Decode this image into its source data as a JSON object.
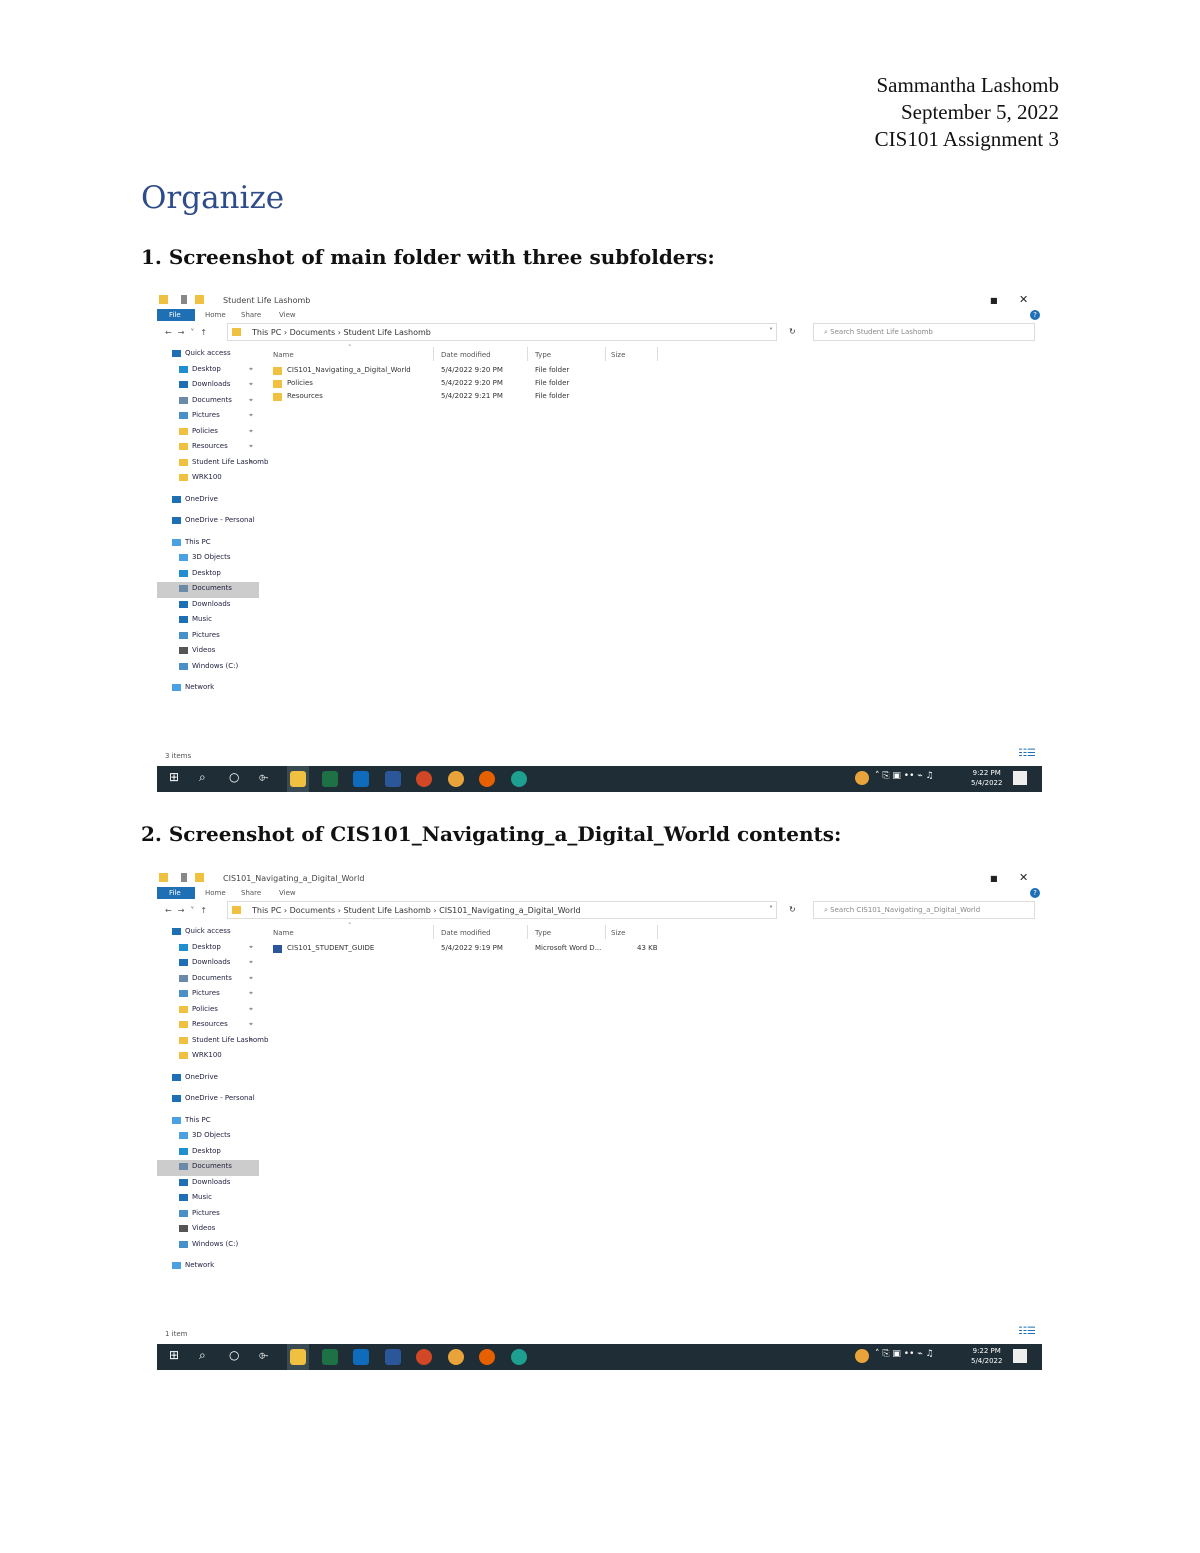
{
  "header": {
    "name": "Sammantha Lashomb",
    "date": "September 5, 2022",
    "course": "CIS101 Assignment 3"
  },
  "title": "Organize",
  "sections": [
    {
      "caption": "1. Screenshot of main folder with three subfolders:",
      "window_title": "Student Life Lashomb",
      "ribbon_tabs": [
        "File",
        "Home",
        "Share",
        "View"
      ],
      "path": "This PC  ›  Documents  ›  Student Life Lashomb",
      "search_placeholder": "Search Student Life Lashomb",
      "columns": [
        "Name",
        "Date modified",
        "Type",
        "Size"
      ],
      "rows": [
        {
          "name": "CIS101_Navigating_a_Digital_World",
          "date": "5/4/2022 9:20 PM",
          "type": "File folder",
          "size": ""
        },
        {
          "name": "Policies",
          "date": "5/4/2022 9:20 PM",
          "type": "File folder",
          "size": ""
        },
        {
          "name": "Resources",
          "date": "5/4/2022 9:21 PM",
          "type": "File folder",
          "size": ""
        }
      ],
      "status": "3 items",
      "clock_time": "9:22 PM",
      "clock_date": "5/4/2022"
    },
    {
      "caption": "2. Screenshot of CIS101_Navigating_a_Digital_World contents:",
      "window_title": "CIS101_Navigating_a_Digital_World",
      "ribbon_tabs": [
        "File",
        "Home",
        "Share",
        "View"
      ],
      "path": "This PC  ›  Documents  ›  Student Life Lashomb  ›  CIS101_Navigating_a_Digital_World",
      "search_placeholder": "Search CIS101_Navigating_a_Digital_World",
      "columns": [
        "Name",
        "Date modified",
        "Type",
        "Size"
      ],
      "rows": [
        {
          "name": "CIS101_STUDENT_GUIDE",
          "date": "5/4/2022 9:19 PM",
          "type": "Microsoft Word D...",
          "size": "43 KB"
        }
      ],
      "status": "1 item",
      "clock_time": "9:22 PM",
      "clock_date": "5/4/2022"
    }
  ],
  "sidebar": [
    {
      "label": "Quick access",
      "icon": "star-icon",
      "pin": false,
      "indent": 0,
      "color": "#1f6fb5"
    },
    {
      "label": "Desktop",
      "icon": "desktop-icon",
      "pin": true,
      "indent": 1,
      "color": "#1f8fd0"
    },
    {
      "label": "Downloads",
      "icon": "download-icon",
      "pin": true,
      "indent": 1,
      "color": "#1f6fb5"
    },
    {
      "label": "Documents",
      "icon": "documents-icon",
      "pin": true,
      "indent": 1,
      "color": "#6a8aa8"
    },
    {
      "label": "Pictures",
      "icon": "pictures-icon",
      "pin": true,
      "indent": 1,
      "color": "#4a90c8"
    },
    {
      "label": "Policies",
      "icon": "folder-icon",
      "pin": true,
      "indent": 1,
      "color": "#f0c040"
    },
    {
      "label": "Resources",
      "icon": "folder-icon",
      "pin": true,
      "indent": 1,
      "color": "#f0c040"
    },
    {
      "label": "Student Life Lashomb",
      "icon": "folder-icon",
      "pin": true,
      "indent": 1,
      "color": "#f0c040"
    },
    {
      "label": "WRK100",
      "icon": "folder-icon",
      "pin": false,
      "indent": 1,
      "color": "#f0c040"
    },
    {
      "gap": true
    },
    {
      "label": "OneDrive",
      "icon": "cloud-icon",
      "pin": false,
      "indent": 0,
      "color": "#1f6fb5"
    },
    {
      "gap": true
    },
    {
      "label": "OneDrive - Personal",
      "icon": "cloud-icon",
      "pin": false,
      "indent": 0,
      "color": "#1f6fb5"
    },
    {
      "gap": true
    },
    {
      "label": "This PC",
      "icon": "computer-icon",
      "pin": false,
      "indent": 0,
      "color": "#4aa0e0"
    },
    {
      "label": "3D Objects",
      "icon": "cube-icon",
      "pin": false,
      "indent": 1,
      "color": "#4aa0e0"
    },
    {
      "label": "Desktop",
      "icon": "desktop-icon",
      "pin": false,
      "indent": 1,
      "color": "#1f8fd0"
    },
    {
      "label": "Documents",
      "icon": "documents-icon",
      "pin": false,
      "indent": 1,
      "color": "#6a8aa8",
      "selected": true
    },
    {
      "label": "Downloads",
      "icon": "download-icon",
      "pin": false,
      "indent": 1,
      "color": "#1f6fb5"
    },
    {
      "label": "Music",
      "icon": "music-icon",
      "pin": false,
      "indent": 1,
      "color": "#1f6fb5"
    },
    {
      "label": "Pictures",
      "icon": "pictures-icon",
      "pin": false,
      "indent": 1,
      "color": "#4a90c8"
    },
    {
      "label": "Videos",
      "icon": "video-icon",
      "pin": false,
      "indent": 1,
      "color": "#555"
    },
    {
      "label": "Windows (C:)",
      "icon": "drive-icon",
      "pin": false,
      "indent": 1,
      "color": "#4a90c8"
    },
    {
      "gap": true
    },
    {
      "label": "Network",
      "icon": "network-icon",
      "pin": false,
      "indent": 0,
      "color": "#4aa0e0"
    }
  ],
  "taskbar_apps": [
    {
      "name": "file-explorer-icon",
      "color": "#f0c040"
    },
    {
      "name": "excel-icon",
      "color": "#1e7145"
    },
    {
      "name": "outlook-icon",
      "color": "#0f6cbd"
    },
    {
      "name": "word-icon",
      "color": "#2b579a"
    },
    {
      "name": "powerpoint-icon",
      "color": "#d24726"
    },
    {
      "name": "chrome-icon",
      "color": "#e8a43a"
    },
    {
      "name": "firefox-icon",
      "color": "#e66000"
    },
    {
      "name": "edge-icon",
      "color": "#1da08f"
    }
  ]
}
